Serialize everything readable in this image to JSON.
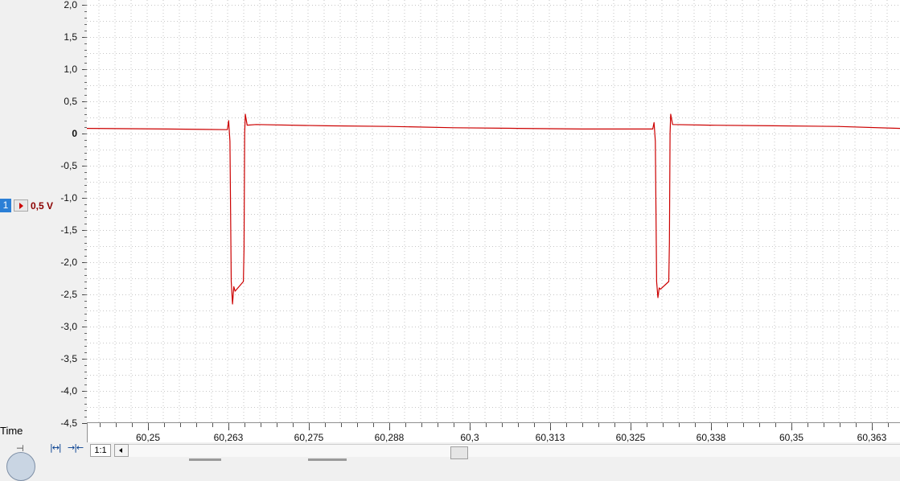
{
  "chart_data": {
    "type": "line",
    "y_ticks": [
      "2,0",
      "1,5",
      "1,0",
      "0,5",
      "0",
      "-0,5",
      "-1,0",
      "-1,5",
      "-2,0",
      "-2,5",
      "-3,0",
      "-3,5",
      "-4,0",
      "-4,5"
    ],
    "x_ticks": [
      "60,25",
      "60,263",
      "60,275",
      "60,288",
      "60,3",
      "60,313",
      "60,325",
      "60,338",
      "60,35",
      "60,363"
    ],
    "ylim": [
      -4.5,
      2.0
    ],
    "xlim": [
      60.2425,
      60.3698
    ],
    "grid": true,
    "series": [
      {
        "color": "#cc0000",
        "x": [
          60.2425,
          60.255,
          60.2645,
          60.2647,
          60.2649,
          60.2651,
          60.2653,
          60.2655,
          60.2657,
          60.267,
          60.2671,
          60.2672,
          60.2673,
          60.2676,
          60.269,
          60.28,
          60.29,
          60.3,
          60.31,
          60.32,
          60.3311,
          60.3313,
          60.3315,
          60.3317,
          60.3319,
          60.3321,
          60.3323,
          60.3336,
          60.3337,
          60.3338,
          60.3339,
          60.3342,
          60.34,
          60.35,
          60.36,
          60.3698
        ],
        "y": [
          0.08,
          0.07,
          0.06,
          0.2,
          -0.12,
          -2.3,
          -2.65,
          -2.38,
          -2.45,
          -2.3,
          -1.8,
          0.0,
          0.3,
          0.13,
          0.14,
          0.12,
          0.11,
          0.09,
          0.08,
          0.07,
          0.07,
          0.17,
          -0.12,
          -2.3,
          -2.55,
          -2.4,
          -2.42,
          -2.3,
          -1.7,
          0.0,
          0.3,
          0.14,
          0.13,
          0.12,
          0.11,
          0.08
        ]
      }
    ]
  },
  "channel": {
    "number": "1",
    "scale": "0,5 V"
  },
  "time_axis": {
    "label": "Time"
  },
  "toolbar": {
    "zoom_ratio": "1:1",
    "expand_icon": "|↔|",
    "compress_icon": "→|←",
    "pin_icon": "⊣"
  },
  "icons": [
    "pin-icon",
    "expand-icon",
    "compress-icon",
    "scroll-left-icon",
    "channel-arrow-icon"
  ]
}
